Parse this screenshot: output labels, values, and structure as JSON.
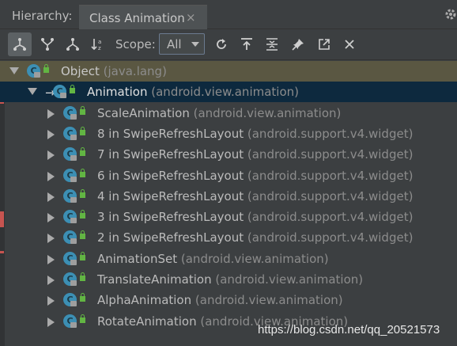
{
  "title_bar": {
    "hierarchy_label": "Hierarchy:",
    "tab_label": "Class Animation",
    "tab_close": "×"
  },
  "toolbar": {
    "buttons": [
      {
        "icon": "class-hierarchy-icon",
        "active": true
      },
      {
        "icon": "supertypes-icon",
        "active": false
      },
      {
        "icon": "subtypes-icon",
        "active": false
      },
      {
        "icon": "sort-alphabetically-icon",
        "active": false
      }
    ],
    "scope_label": "Scope:",
    "scope_value": "All",
    "right_buttons": [
      {
        "icon": "refresh-icon"
      },
      {
        "icon": "export-icon"
      },
      {
        "icon": "collapse-all-icon"
      },
      {
        "icon": "pin-icon"
      },
      {
        "icon": "open-in-window-icon"
      },
      {
        "icon": "close-icon"
      }
    ]
  },
  "tree": {
    "rows": [
      {
        "name": "Object",
        "pkg": "(java.lang)",
        "level": 0,
        "expanded": true,
        "style": "top"
      },
      {
        "name": "Animation",
        "pkg": "(android.view.animation)",
        "level": 1,
        "expanded": true,
        "style": "selected",
        "focused_arrow": "→"
      },
      {
        "name": "ScaleAnimation",
        "pkg": "(android.view.animation)",
        "level": 2,
        "expanded": false,
        "style": "normal"
      },
      {
        "name": "8 in SwipeRefreshLayout",
        "pkg": "(android.support.v4.widget)",
        "level": 2,
        "expanded": false,
        "style": "normal"
      },
      {
        "name": "7 in SwipeRefreshLayout",
        "pkg": "(android.support.v4.widget)",
        "level": 2,
        "expanded": false,
        "style": "normal"
      },
      {
        "name": "6 in SwipeRefreshLayout",
        "pkg": "(android.support.v4.widget)",
        "level": 2,
        "expanded": false,
        "style": "normal"
      },
      {
        "name": "4 in SwipeRefreshLayout",
        "pkg": "(android.support.v4.widget)",
        "level": 2,
        "expanded": false,
        "style": "normal"
      },
      {
        "name": "3 in SwipeRefreshLayout",
        "pkg": "(android.support.v4.widget)",
        "level": 2,
        "expanded": false,
        "style": "normal"
      },
      {
        "name": "2 in SwipeRefreshLayout",
        "pkg": "(android.support.v4.widget)",
        "level": 2,
        "expanded": false,
        "style": "normal"
      },
      {
        "name": "AnimationSet",
        "pkg": "(android.view.animation)",
        "level": 2,
        "expanded": false,
        "style": "normal"
      },
      {
        "name": "TranslateAnimation",
        "pkg": "(android.view.animation)",
        "level": 2,
        "expanded": false,
        "style": "normal"
      },
      {
        "name": "AlphaAnimation",
        "pkg": "(android.view.animation)",
        "level": 2,
        "expanded": false,
        "style": "normal"
      },
      {
        "name": "RotateAnimation",
        "pkg": "(android.view.animation)",
        "level": 2,
        "expanded": false,
        "style": "normal"
      }
    ],
    "class_icon_letter": "C"
  },
  "watermark": "https://blog.csdn.net/qq_20521573",
  "colors": {
    "background": "#3c3f41",
    "selected_row": "#0d293e",
    "top_row": "#5a5742",
    "class_icon": "#3c8fb4",
    "lock": "#62b543",
    "gutter_mark": "#c75450"
  }
}
